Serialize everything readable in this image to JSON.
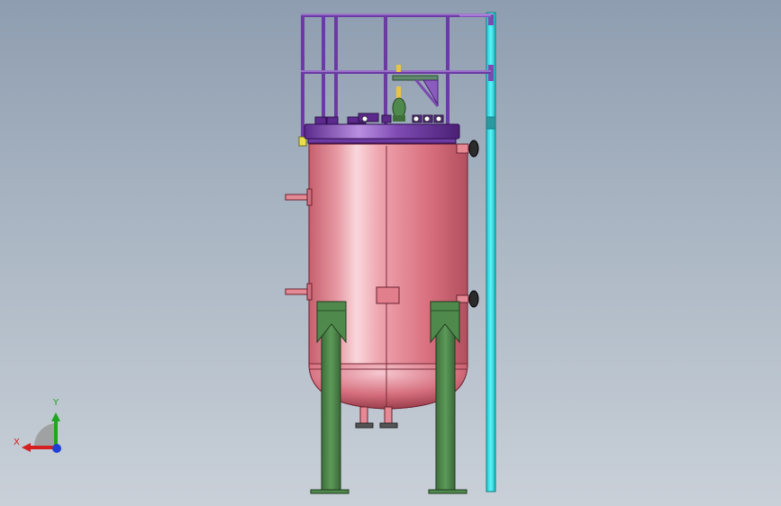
{
  "viewport": {
    "background_top": "#8e9db0",
    "background_bottom": "#c9d0d8"
  },
  "model": {
    "shell_color": "#e58a95",
    "leg_color": "#4f8a4c",
    "railing_color": "#7b4bb0",
    "ladder_color": "#29e0e8"
  },
  "triad": {
    "x_label": "X",
    "y_label": "Y",
    "x_color": "#d42020",
    "y_color": "#1fa51f",
    "z_color": "#1f3fd4"
  }
}
